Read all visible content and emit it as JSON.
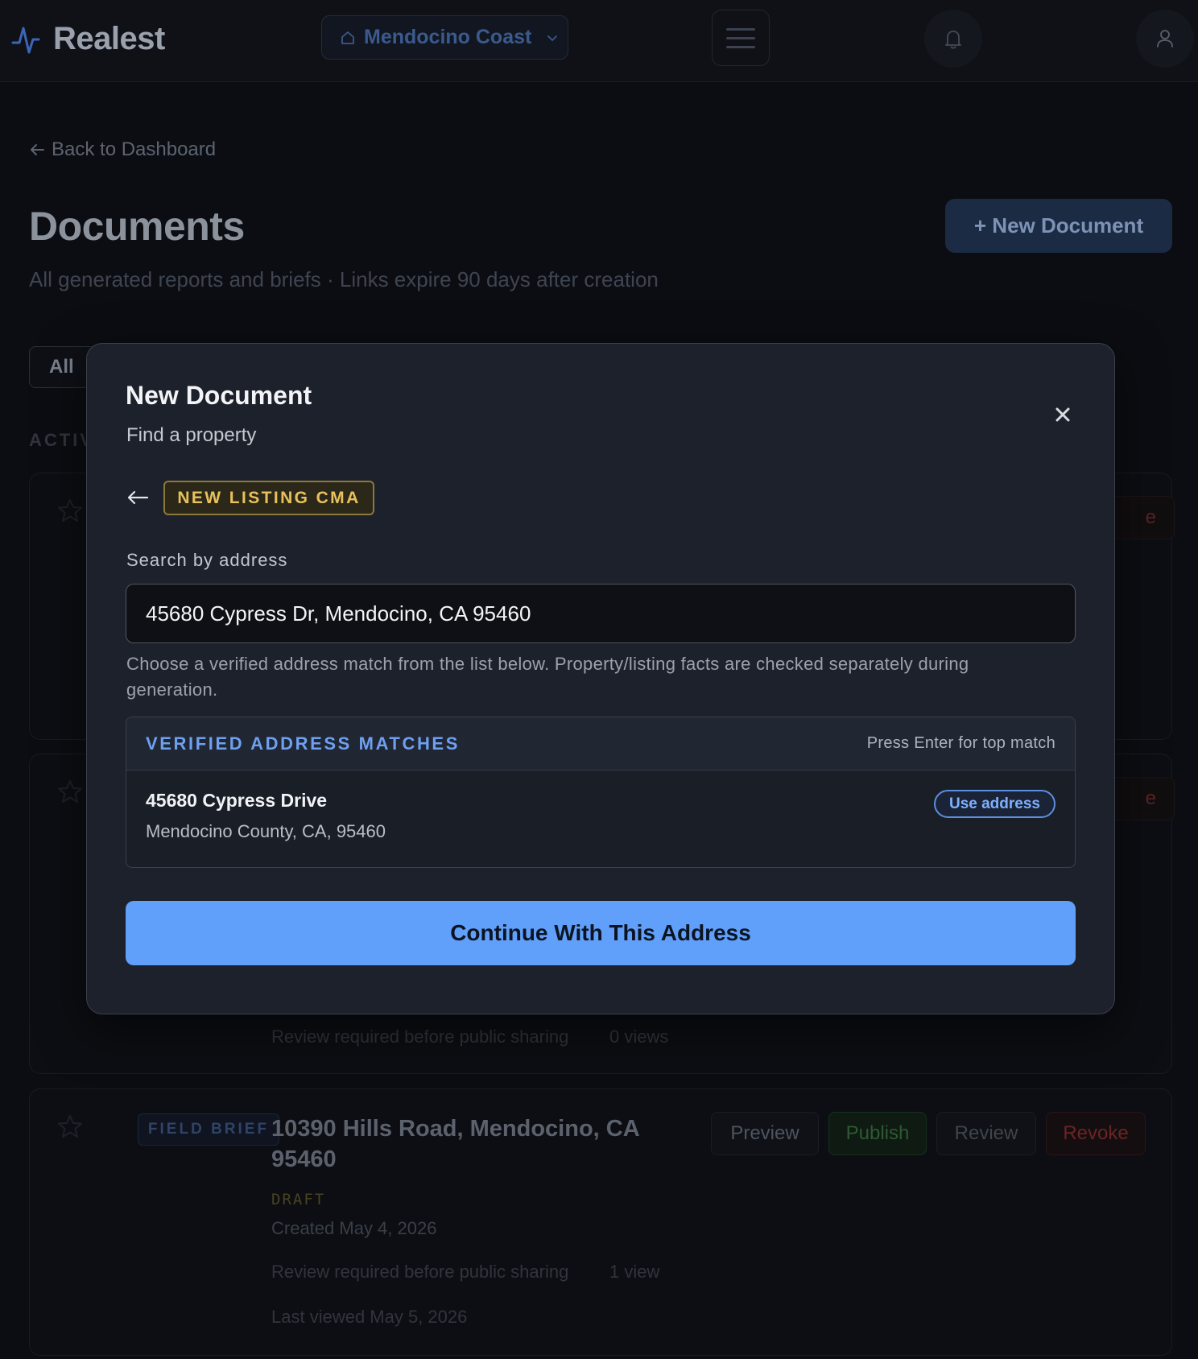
{
  "app": {
    "brand": "Realest",
    "market": "Mendocino Coast"
  },
  "page": {
    "back_link": "Back to Dashboard",
    "title": "Documents",
    "subtitle": "All generated reports and briefs · Links expire 90 days after creation",
    "new_document_button": "+ New Document",
    "filter_all": "All",
    "section_label": "ACTIV"
  },
  "cards": [
    {
      "peek_action": "e"
    },
    {
      "peek_action": "e",
      "review_note": "Review required before public sharing",
      "views": "0 views"
    },
    {
      "tag": "FIELD BRIEF",
      "title": "10390 Hills Road, Mendocino, CA 95460",
      "status": "DRAFT",
      "created": "Created May 4, 2026",
      "review_note": "Review required before public sharing",
      "views": "1 view",
      "last_viewed": "Last viewed May 5, 2026",
      "actions": {
        "preview": "Preview",
        "publish": "Publish",
        "review": "Review",
        "revoke": "Revoke"
      }
    }
  ],
  "modal": {
    "title": "New Document",
    "subtitle": "Find a property",
    "doc_type_badge": "NEW LISTING CMA",
    "search_label": "Search by address",
    "search_value": "45680 Cypress Dr, Mendocino, CA 95460",
    "hint": "Choose a verified address match from the list below. Property/listing facts are checked separately during generation.",
    "matches_title": "VERIFIED ADDRESS MATCHES",
    "matches_hint": "Press Enter for top match",
    "matches": [
      {
        "street": "45680 Cypress Drive",
        "locality": "Mendocino County, CA, 95460",
        "action": "Use address"
      }
    ],
    "continue_button": "Continue With This Address"
  },
  "colors": {
    "accent_blue": "#60a0fa",
    "badge_gold": "#e8c15c",
    "modal_bg": "#1d212b",
    "page_bg": "#0b0d12"
  },
  "icons": [
    "pulse-logo-icon",
    "home-icon",
    "chevron-down-icon",
    "hamburger-icon",
    "bell-icon",
    "user-icon",
    "arrow-left-icon",
    "close-icon",
    "star-icon"
  ]
}
